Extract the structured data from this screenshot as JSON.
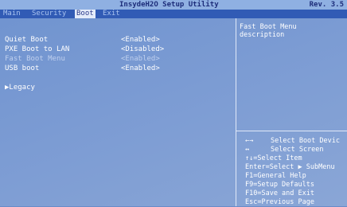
{
  "title_bar": {
    "title": "InsydeH2O Setup Utility",
    "revision": "Rev. 3.5"
  },
  "menu": {
    "tabs": [
      {
        "label": "Main",
        "active": false
      },
      {
        "label": "Security",
        "active": false
      },
      {
        "label": "Boot",
        "active": true
      },
      {
        "label": "Exit",
        "active": false
      }
    ]
  },
  "boot_options": [
    {
      "label": "Quiet Boot",
      "value": "<Enabled>",
      "selected": true,
      "enabled": true
    },
    {
      "label": "PXE Boot to LAN",
      "value": "<Disabled>",
      "selected": false,
      "enabled": true
    },
    {
      "label": "Fast Boot Menu",
      "value": "<Enabled>",
      "selected": false,
      "enabled": false
    },
    {
      "label": "USB boot",
      "value": "<Enabled>",
      "selected": false,
      "enabled": true
    }
  ],
  "submenu": {
    "label": "▶Legacy"
  },
  "help": {
    "description": "Fast Boot Menu description"
  },
  "key_legend": [
    {
      "key": "←→",
      "action": "Select Boot Devic"
    },
    {
      "key": "↔",
      "action": "Select Screen"
    },
    {
      "key": "",
      "action": "↑↓=Select Item"
    },
    {
      "key": "",
      "action": "Enter=Select ▶ SubMenu"
    },
    {
      "key": "",
      "action": "F1=General Help"
    },
    {
      "key": "",
      "action": "F9=Setup Defaults"
    },
    {
      "key": "",
      "action": "F10=Save and Exit"
    },
    {
      "key": "",
      "action": "Esc=Previous Page"
    }
  ]
}
